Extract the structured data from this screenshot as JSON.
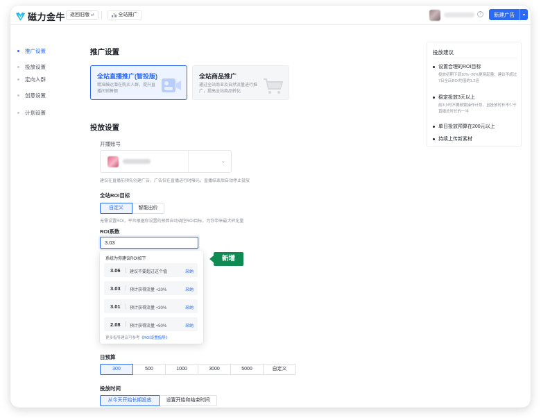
{
  "app": {
    "logo_text": "磁力金牛",
    "back_label": "返回旧版",
    "breadcrumb": "全站推广",
    "new_ad_label": "新建广告",
    "help_glyph": "?",
    "brand_color": "#2a6af5"
  },
  "sidebar": {
    "items": [
      {
        "label": "推广设置",
        "active": true
      },
      {
        "label": "投放设置",
        "active": false
      },
      {
        "label": "定向人群",
        "active": false
      },
      {
        "label": "创意设置",
        "active": false
      },
      {
        "label": "计划设置",
        "active": false
      }
    ]
  },
  "promo": {
    "section_title": "推广设置",
    "card_selected": {
      "title": "全站直播推广(智投版)",
      "desc": "精准触达潜在购买人群，提升直播间销售额"
    },
    "card_other": {
      "title": "全站商品推广",
      "desc": "通过全站商业及自然流量进行推广，提高全站商品转化"
    }
  },
  "delivery": {
    "section_title": "投放设置",
    "anchor_label": "开播账号",
    "anchor_hint": "建议在直播前预先创建广告，广告仅在直播进行时曝光，直播结束后自动停止投放",
    "roi_target_label": "全站ROI目标",
    "roi_target_options": [
      {
        "label": "自定义",
        "selected": true
      },
      {
        "label": "智能出价",
        "selected": false
      }
    ],
    "roi_target_hint": "无需设置ROI，平台根据你设置的预算自动调控ROI目标，为你带来最大转化量",
    "roi_coef_label": "ROI系数",
    "roi_value": "3.03",
    "dropdown": {
      "header": "系统为你建议ROI如下",
      "suggestions": [
        {
          "value": "3.06",
          "desc": "建议不要超过这个值",
          "action": "采纳"
        },
        {
          "value": "3.03",
          "desc": "预计获得流量 +20%",
          "action": "采纳"
        },
        {
          "value": "3.01",
          "desc": "预计获得流量 +30%",
          "action": "采纳"
        },
        {
          "value": "2.08",
          "desc": "预计获得流量 +50%",
          "action": "采纳"
        }
      ],
      "footer_text": "更多指导建议可参考",
      "footer_link": "《ROI设置指导》"
    },
    "new_tag": "新增",
    "budget_label": "日预算",
    "budget_options": [
      {
        "label": "300",
        "selected": true
      },
      {
        "label": "500",
        "selected": false
      },
      {
        "label": "1000",
        "selected": false
      },
      {
        "label": "3000",
        "selected": false
      },
      {
        "label": "5000",
        "selected": false
      },
      {
        "label": "自定义",
        "selected": false
      }
    ],
    "time_label": "投放时间",
    "time_options": [
      {
        "label": "从今天开始长期投放",
        "selected": true
      },
      {
        "label": "设置开始和结束时间",
        "selected": false
      }
    ]
  },
  "tips": {
    "title": "投放建议",
    "items": [
      {
        "heading": "设置合理的ROI目标",
        "body": "投放初期下调10%~20%更易起量；建议不超过7日全店ROI均值的1.2倍"
      },
      {
        "heading": "稳定投放3天以上",
        "body": "前3小时不要频繁操作计划，且投放时长不少于直播总时长的一半"
      },
      {
        "heading": "单日投放预算在200元以上",
        "body": ""
      },
      {
        "heading": "持续上传新素材",
        "body": ""
      }
    ]
  }
}
